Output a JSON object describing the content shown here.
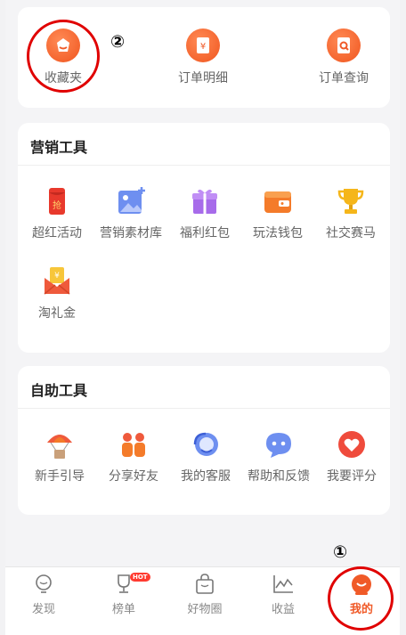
{
  "top_row": [
    {
      "label": "收藏夹",
      "icon": "favorites-icon",
      "color": "#f05a28"
    },
    {
      "label": "订单明细",
      "icon": "order-detail-icon",
      "color": "#f05a28"
    },
    {
      "label": "订单查询",
      "icon": "order-search-icon",
      "color": "#f05a28"
    }
  ],
  "marketing": {
    "title": "营销工具",
    "items": [
      {
        "label": "超红活动",
        "icon": "red-envelope-icon",
        "glyph": "抢"
      },
      {
        "label": "营销素材库",
        "icon": "image-add-icon"
      },
      {
        "label": "福利红包",
        "icon": "gift-icon"
      },
      {
        "label": "玩法钱包",
        "icon": "wallet-icon"
      },
      {
        "label": "社交赛马",
        "icon": "trophy-icon"
      },
      {
        "label": "淘礼金",
        "icon": "money-envelope-icon",
        "glyph": "¥"
      }
    ]
  },
  "self_service": {
    "title": "自助工具",
    "items": [
      {
        "label": "新手引导",
        "icon": "parachute-icon"
      },
      {
        "label": "分享好友",
        "icon": "share-friends-icon"
      },
      {
        "label": "我的客服",
        "icon": "customer-service-icon"
      },
      {
        "label": "帮助和反馈",
        "icon": "chat-bubble-icon"
      },
      {
        "label": "我要评分",
        "icon": "heart-icon"
      }
    ]
  },
  "tabs": [
    {
      "label": "发现",
      "icon": "bulb-icon",
      "active": false
    },
    {
      "label": "榜单",
      "icon": "trophy-outline-icon",
      "badge": "HOT",
      "active": false
    },
    {
      "label": "好物圈",
      "icon": "shopping-bag-icon",
      "active": false
    },
    {
      "label": "收益",
      "icon": "line-chart-icon",
      "active": false
    },
    {
      "label": "我的",
      "icon": "profile-icon",
      "active": true
    }
  ],
  "annotations": {
    "one": "①",
    "two": "②"
  },
  "colors": {
    "accent": "#f05a28",
    "annotation": "#e00000"
  }
}
